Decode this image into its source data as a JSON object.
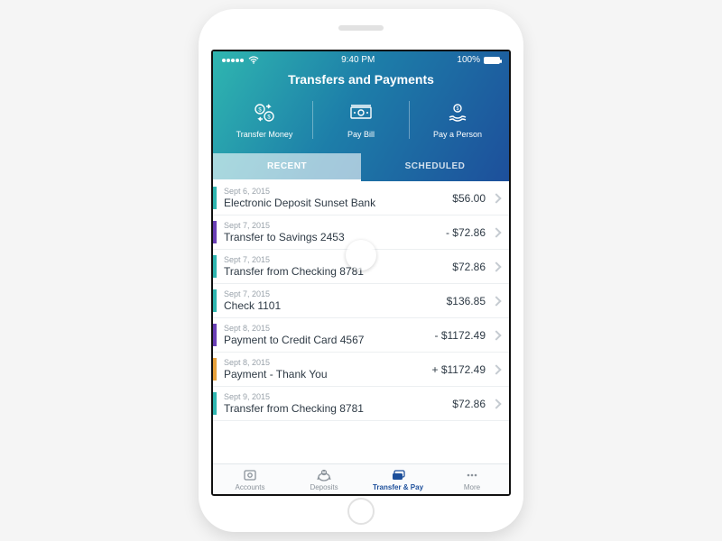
{
  "status": {
    "time": "9:40 PM",
    "battery": "100%"
  },
  "page_title": "Transfers and Payments",
  "actions": [
    {
      "label": "Transfer Money"
    },
    {
      "label": "Pay Bill"
    },
    {
      "label": "Pay a Person"
    }
  ],
  "tabs": {
    "recent": "RECENT",
    "scheduled": "SCHEDULED",
    "active": "recent"
  },
  "stripe_colors": {
    "teal": "#2fb6b0",
    "purple": "#6a3fb5",
    "orange": "#e7a13c"
  },
  "transactions": [
    {
      "date": "Sept 6, 2015",
      "desc": "Electronic Deposit Sunset Bank",
      "amount": "$56.00",
      "stripe": "teal"
    },
    {
      "date": "Sept 7, 2015",
      "desc": "Transfer to Savings 2453",
      "amount": "- $72.86",
      "stripe": "purple"
    },
    {
      "date": "Sept 7, 2015",
      "desc": "Transfer from Checking 8781",
      "amount": "$72.86",
      "stripe": "teal"
    },
    {
      "date": "Sept 7, 2015",
      "desc": "Check 1101",
      "amount": "$136.85",
      "stripe": "teal"
    },
    {
      "date": "Sept 8, 2015",
      "desc": "Payment to Credit Card 4567",
      "amount": "- $1172.49",
      "stripe": "purple"
    },
    {
      "date": "Sept 8, 2015",
      "desc": "Payment - Thank You",
      "amount": "+ $1172.49",
      "stripe": "orange"
    },
    {
      "date": "Sept 9, 2015",
      "desc": "Transfer from Checking 8781",
      "amount": "$72.86",
      "stripe": "teal"
    }
  ],
  "bottom_nav": [
    {
      "label": "Accounts"
    },
    {
      "label": "Deposits"
    },
    {
      "label": "Transfer & Pay"
    },
    {
      "label": "More"
    }
  ],
  "bottom_nav_active": 2
}
